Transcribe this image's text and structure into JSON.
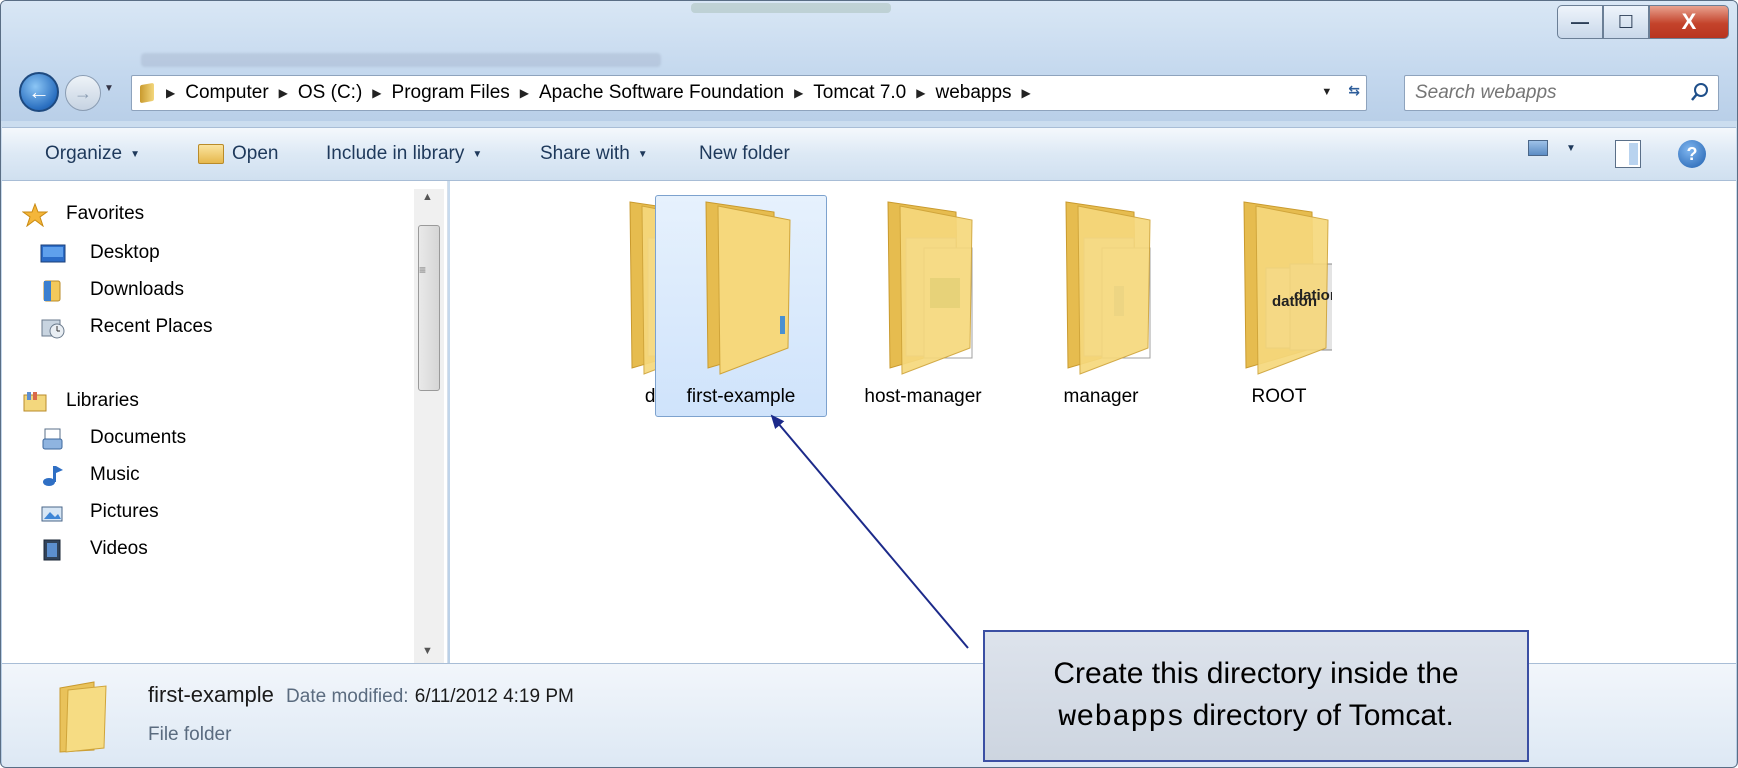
{
  "window": {
    "controls": {
      "minimize": "—",
      "maximize": "☐",
      "close": "X"
    }
  },
  "navigation": {
    "back": "←",
    "forward": "→",
    "breadcrumbs": [
      "Computer",
      "OS (C:)",
      "Program Files",
      "Apache Software Foundation",
      "Tomcat 7.0",
      "webapps"
    ]
  },
  "search": {
    "placeholder": "Search webapps"
  },
  "toolbar": {
    "organize": "Organize",
    "open": "Open",
    "include_in_library": "Include in library",
    "share_with": "Share with",
    "new_folder": "New folder"
  },
  "sidebar": {
    "favorites": {
      "label": "Favorites",
      "items": [
        "Desktop",
        "Downloads",
        "Recent Places"
      ]
    },
    "libraries": {
      "label": "Libraries",
      "items": [
        "Documents",
        "Music",
        "Pictures",
        "Videos"
      ]
    }
  },
  "folders": [
    {
      "name": "docs",
      "selected": false
    },
    {
      "name": "first-example",
      "selected": true
    },
    {
      "name": "host-manager",
      "selected": false
    },
    {
      "name": "manager",
      "selected": false
    },
    {
      "name": "ROOT",
      "selected": false
    }
  ],
  "folder_overlay_text": {
    "root_preview": "dation"
  },
  "details": {
    "name": "first-example",
    "date_label": "Date modified:",
    "date_value": "6/11/2012 4:19 PM",
    "type": "File folder"
  },
  "annotation": {
    "line1": "Create this directory inside the",
    "code": "webapps",
    "line2_rest": " directory of Tomcat."
  },
  "colors": {
    "accent": "#3b4fa3",
    "selection": "#cfe3fb",
    "folder": "#f3d77d"
  }
}
